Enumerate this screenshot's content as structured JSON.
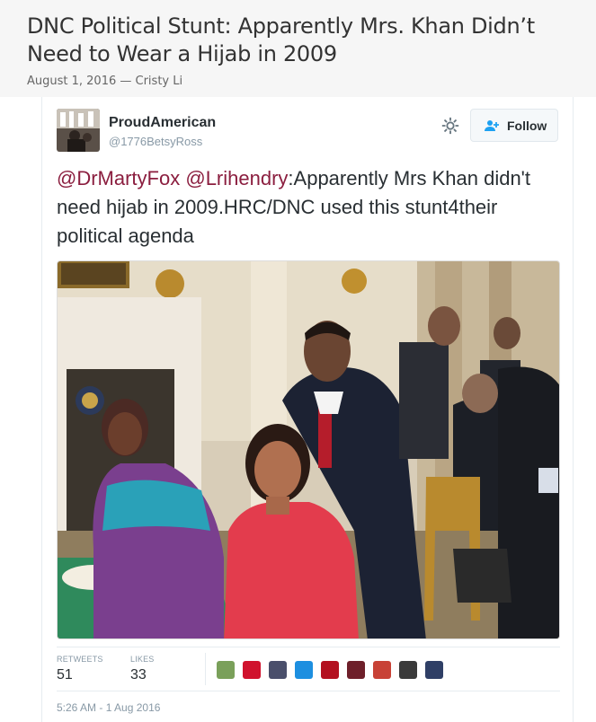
{
  "article": {
    "title": "DNC Political Stunt: Apparently Mrs. Khan Didn’t Need to Wear a Hijab in 2009",
    "meta": "August 1, 2016 — Cristy Li"
  },
  "tweet": {
    "author_name": "ProudAmerican",
    "author_handle": "@1776BetsyRoss",
    "follow_label": "Follow",
    "mention1": "@DrMartyFox",
    "mention2": "@Lrihendry",
    "text_rest": ":Apparently Mrs Khan didn't need hijab in 2009.HRC/DNC used this stunt4their political agenda",
    "retweets_label": "RETWEETS",
    "retweets": "51",
    "likes_label": "LIKES",
    "likes": "33",
    "timestamp": "5:26 AM - 1 Aug 2016",
    "liker_colors": [
      "#7aa05a",
      "#d0122d",
      "#4a4f6b",
      "#1d8fe0",
      "#b3101f",
      "#6e1f2a",
      "#c84236",
      "#3a3a3a",
      "#2f3f66"
    ]
  },
  "icons": {
    "gear": "gear-icon",
    "follow": "add-user-icon"
  }
}
